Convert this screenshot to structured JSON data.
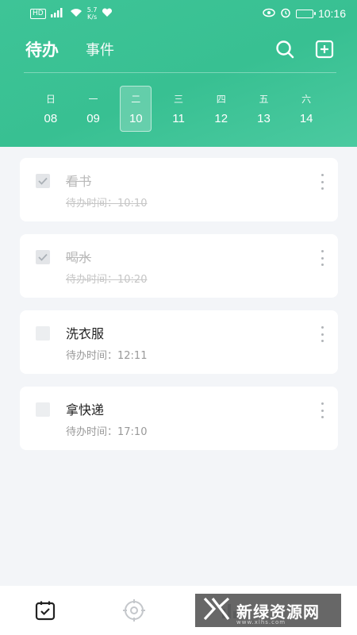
{
  "status_bar": {
    "network_badge": "HD",
    "signal_label": "⁴ᴳ",
    "speed_value": "5.7",
    "speed_unit": "K/s",
    "time": "10:16"
  },
  "header": {
    "tabs": [
      {
        "label": "待办",
        "active": true
      },
      {
        "label": "事件",
        "active": false
      }
    ],
    "icons": [
      "search-icon",
      "add-icon"
    ]
  },
  "week": {
    "days": [
      {
        "name": "日",
        "date": "08"
      },
      {
        "name": "一",
        "date": "09"
      },
      {
        "name": "二",
        "date": "10",
        "selected": true
      },
      {
        "name": "三",
        "date": "11"
      },
      {
        "name": "四",
        "date": "12"
      },
      {
        "name": "五",
        "date": "13"
      },
      {
        "name": "六",
        "date": "14"
      }
    ]
  },
  "todos": [
    {
      "title": "看书",
      "time": "待办时间：10:10",
      "done": true
    },
    {
      "title": "喝水",
      "time": "待办时间：10:20",
      "done": true
    },
    {
      "title": "洗衣服",
      "time": "待办时间：12:11",
      "done": false
    },
    {
      "title": "拿快递",
      "time": "待办时间：17:10",
      "done": false
    }
  ],
  "bottom_nav": {
    "items": [
      "todo-calendar-icon",
      "focus-target-icon",
      "stats-icon"
    ]
  },
  "watermark": {
    "text": "新绿资源网",
    "url": "www.xlhs.com"
  },
  "colors": {
    "accent": "#3ec497",
    "background": "#f3f5f8",
    "card": "#ffffff",
    "done_text": "#b8b8b8"
  }
}
